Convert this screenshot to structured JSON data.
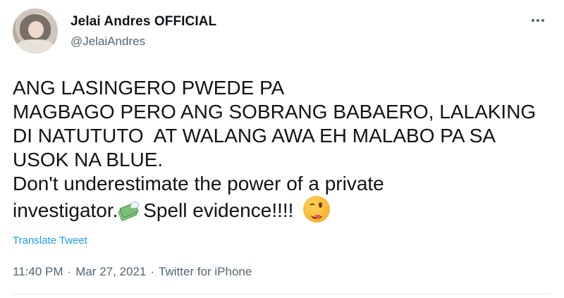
{
  "author": {
    "display_name": "Jelai Andres OFFICIAL",
    "handle": "@JelaiAndres"
  },
  "tweet": {
    "lines": [
      "ANG LASINGERO PWEDE PA",
      "MAGBAGO PERO ANG SOBRANG BABAERO, LALAKING",
      "DI NATUTUTO  AT WALANG AWA EH MALABO PA SA",
      "USOK NA BLUE.",
      "Don't underestimate the power of a private"
    ],
    "last_line_part1": "investigator.",
    "last_line_part2": " Spell evidence!!!!"
  },
  "translate_label": "Translate Tweet",
  "meta": {
    "time": "11:40 PM",
    "date": "Mar 27, 2021",
    "source": "Twitter for iPhone",
    "separator": "·"
  },
  "icons": {
    "more": "more-horizontal-icon",
    "emoji1": "money-with-wings-emoji",
    "emoji2": "winking-face-with-tongue-emoji"
  },
  "colors": {
    "text": "#0f1419",
    "secondary": "#536471",
    "link": "#1d9bf0"
  }
}
